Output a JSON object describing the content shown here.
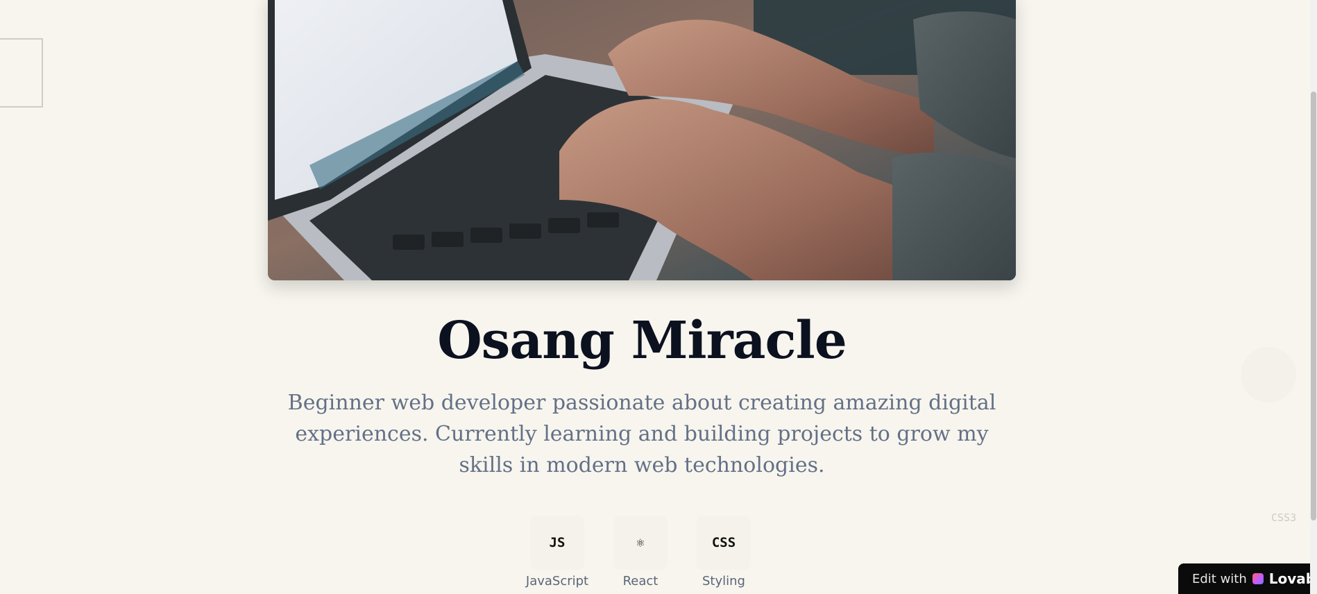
{
  "hero": {
    "image_alt": "hands-typing-on-laptop"
  },
  "profile": {
    "name": "Osang Miracle",
    "bio": "Beginner web developer passionate about creating amazing digital experiences. Currently learning and building projects to grow my skills in modern web technologies."
  },
  "skills": [
    {
      "icon_text": "JS",
      "label": "JavaScript"
    },
    {
      "icon_text": "⚛",
      "label": "React"
    },
    {
      "icon_text": "CSS",
      "label": "Styling"
    }
  ],
  "floating_code": {
    "css3": "CSS3"
  },
  "lovable_badge": {
    "edit_label": "Edit with",
    "brand": "Lovable"
  },
  "colors": {
    "background": "#f7f5ee",
    "name": "#0c1120",
    "bio": "#637086",
    "badge_bg": "#0b0b0b"
  }
}
